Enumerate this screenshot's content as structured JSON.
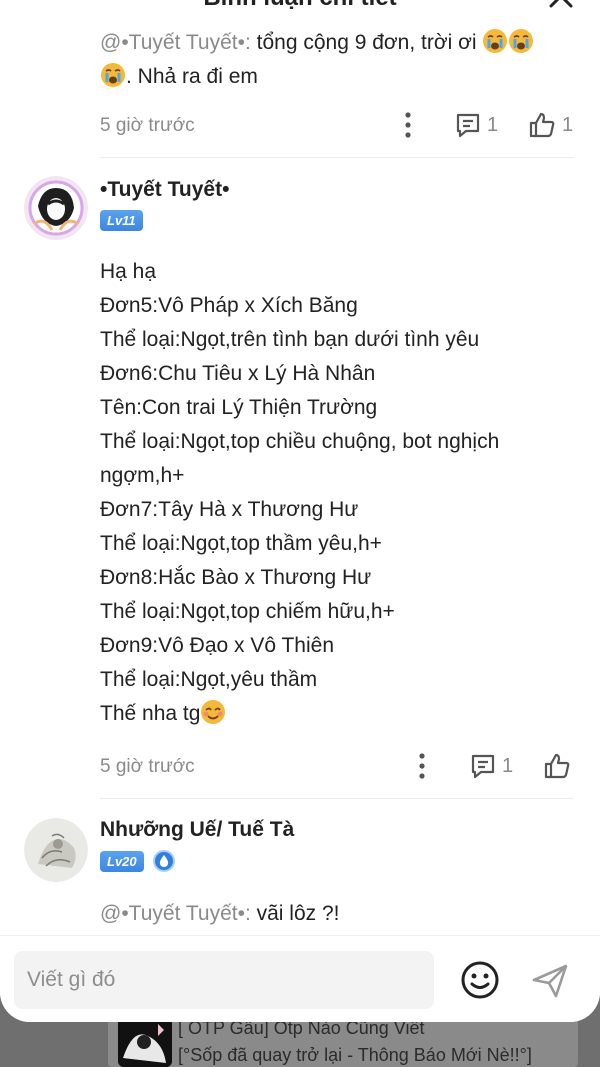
{
  "header": {
    "title": "Bình luận chi tiết"
  },
  "comments": [
    {
      "mention": "@•Tuyết Tuyết•:",
      "text_line1": " tổng cộng 9 đơn, trời ơi ",
      "text_line2": ". Nhả ra đi em",
      "time": "5 giờ trước",
      "reply_count": "1",
      "like_count": "1"
    },
    {
      "username": "•Tuyết Tuyết•",
      "level": "Lv11",
      "lines": [
        "Hạ hạ",
        "Đơn5:Vô Pháp x Xích Băng",
        "Thể loại:Ngọt,trên tình bạn dưới tình yêu",
        "Đơn6:Chu Tiêu x Lý Hà Nhân",
        "Tên:Con trai Lý Thiện Trường",
        "Thể loại:Ngọt,top chiều chuộng, bot nghịch",
        "ngợm,h+",
        "Đơn7:Tây Hà x Thương Hư",
        "Thể loại:Ngọt,top thầm yêu,h+",
        "Đơn8:Hắc Bào x Thương Hư",
        "Thể loại:Ngọt,top chiếm hữu,h+",
        "Đơn9:Vô Đạo x Vô Thiên",
        "Thể loại:Ngọt,yêu thầm"
      ],
      "last_line": "Thế nha tg",
      "time": "5 giờ trước",
      "reply_count": "1"
    },
    {
      "username": "Nhưỡng Uế/ Tuế Tà",
      "level": "Lv20",
      "mention": "@•Tuyết Tuyết•:",
      "text": " vãi lôz ?!"
    }
  ],
  "input": {
    "placeholder": "Viết gì đó"
  },
  "background_post": {
    "title": "[ OTP Gâu] Otp Nào Cũng Viết",
    "subtitle": "[°Sốp đã quay trở lại - Thông Báo Mới Nè!!°]"
  },
  "colors": {
    "accent_blue": "#3d86e0",
    "muted_text": "#8a8a8a"
  }
}
